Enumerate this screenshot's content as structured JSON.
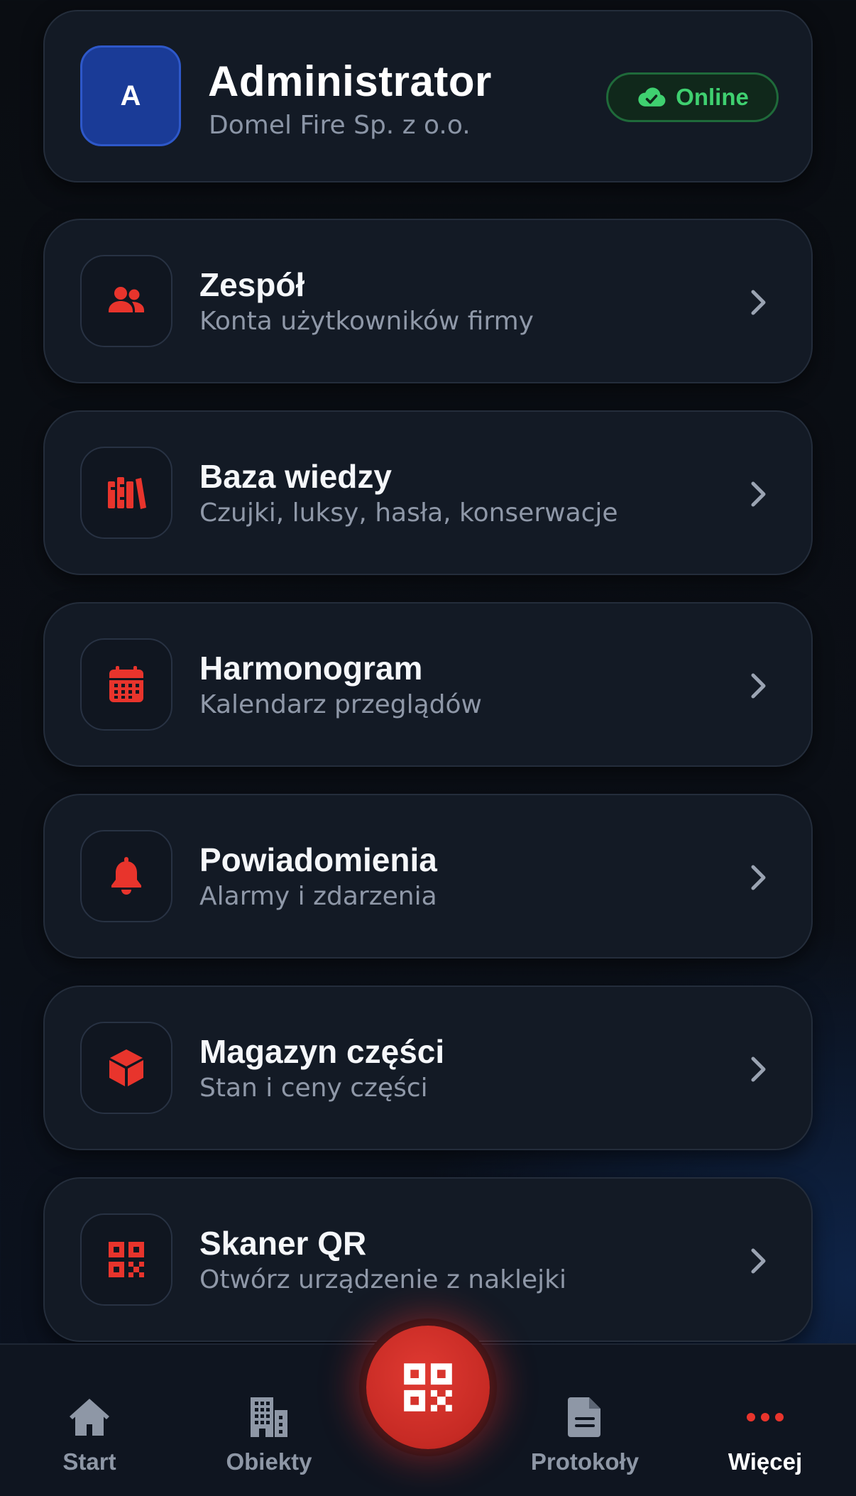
{
  "profile": {
    "avatar_letter": "A",
    "name": "Administrator",
    "company": "Domel Fire Sp. z o.o.",
    "status": "Online",
    "status_icon": "cloud-check-icon",
    "status_color": "#3fd070"
  },
  "accent_color": "#e8342c",
  "menu": [
    {
      "icon": "team-icon",
      "title": "Zespół",
      "subtitle": "Konta użytkowników firmy"
    },
    {
      "icon": "books-icon",
      "title": "Baza wiedzy",
      "subtitle": "Czujki, luksy, hasła, konserwacje"
    },
    {
      "icon": "calendar-icon",
      "title": "Harmonogram",
      "subtitle": "Kalendarz przeglądów"
    },
    {
      "icon": "bell-icon",
      "title": "Powiadomienia",
      "subtitle": "Alarmy i zdarzenia"
    },
    {
      "icon": "box-icon",
      "title": "Magazyn części",
      "subtitle": "Stan i ceny części"
    },
    {
      "icon": "qr-code-icon",
      "title": "Skaner QR",
      "subtitle": "Otwórz urządzenie z naklejki"
    }
  ],
  "nav": {
    "items": [
      {
        "icon": "home-icon",
        "label": "Start"
      },
      {
        "icon": "building-icon",
        "label": "Obiekty"
      },
      {
        "icon": "document-icon",
        "label": "Protokoły"
      },
      {
        "icon": "more-dots-icon",
        "label": "Więcej",
        "active": true
      }
    ],
    "center_button_icon": "qr-code-icon"
  }
}
